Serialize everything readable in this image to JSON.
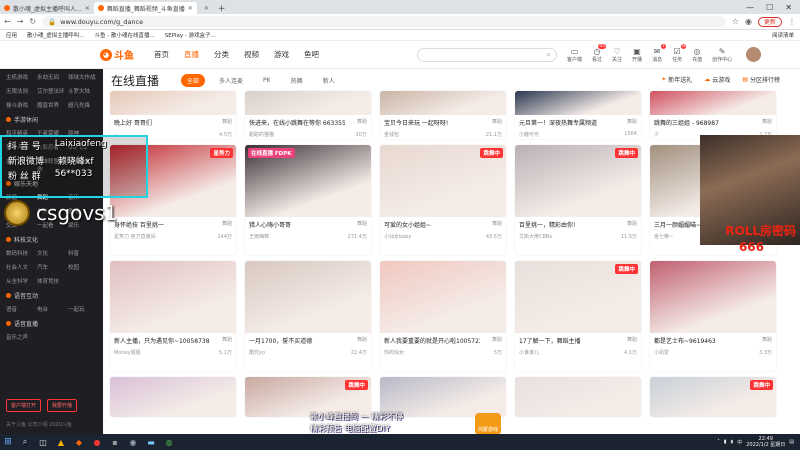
{
  "browser": {
    "tabs": [
      {
        "label": "散小魂_虚拟主播呼叫人...",
        "active": false
      },
      {
        "label": "舞蹈直播_舞蹈视频_斗鱼直播",
        "active": true
      },
      {
        "label": "",
        "active": false
      }
    ],
    "url": "www.douyu.com/g_dance",
    "update_label": "更新",
    "bookmarks": [
      "应用",
      "散小魂_虚拟主播呼叫...",
      "斗鱼 - 散小魂在线直播...",
      "SEPlay - 游戏盒子..."
    ],
    "reading_list": "阅读清单"
  },
  "site": {
    "logo": "斗鱼",
    "nav": [
      {
        "label": "首页",
        "active": false
      },
      {
        "label": "直播",
        "active": true
      },
      {
        "label": "分类",
        "active": false
      },
      {
        "label": "视频",
        "active": false
      },
      {
        "label": "游戏",
        "active": false
      },
      {
        "label": "鱼吧",
        "active": false
      }
    ],
    "search_icon": "search-icon",
    "header_icons": [
      {
        "label": "客户端",
        "icon": "download-icon",
        "badge": ""
      },
      {
        "label": "看过",
        "icon": "history-icon",
        "badge": "45"
      },
      {
        "label": "关注",
        "icon": "follow-icon",
        "badge": ""
      },
      {
        "label": "开播",
        "icon": "broadcast-icon",
        "badge": ""
      },
      {
        "label": "消息",
        "icon": "message-icon",
        "badge": "1"
      },
      {
        "label": "任务",
        "icon": "task-icon",
        "badge": "8"
      },
      {
        "label": "充值",
        "icon": "recharge-icon",
        "badge": ""
      },
      {
        "label": "创作中心",
        "icon": "create-icon",
        "badge": ""
      }
    ]
  },
  "sidebar": {
    "top_items": [
      "主机游戏",
      "永劫无间",
      "球球大作战",
      "无限法则",
      "艾尔登法环",
      "斗罗大陆",
      "格斗游戏",
      "魔兽世界",
      "超凡先锋"
    ],
    "section1": "手游休闲",
    "section1_items": [
      "和平精英",
      "王者荣耀",
      "原神",
      "第五人格",
      "火影忍者",
      "QQ飞车",
      "金铲铲",
      "英雄联盟手游",
      "热门游戏"
    ],
    "section2": "娱乐天地",
    "section2_items": [
      "颜值",
      "舞蹈",
      "音乐",
      "二次元",
      "户外",
      "鱼塘",
      "交友",
      "一起看",
      "娱乐"
    ],
    "section3": "科技文化",
    "section3_items": [
      "数码科技",
      "文化",
      "科普",
      "社会人文",
      "汽车",
      "校园",
      "从全科学",
      "体育竞技"
    ],
    "section4": "语音互动",
    "section4_items": [
      "语音",
      "电台",
      "一起玩"
    ],
    "section5": "语音直播",
    "section5_items": [
      "音乐之声"
    ],
    "btn_client": "客户端打开",
    "btn_start": "我要开播",
    "footer": "关于斗鱼  公司介绍  2020斗鱼"
  },
  "page": {
    "title": "在线直播",
    "filters": [
      {
        "label": "全部",
        "active": true
      },
      {
        "label": "多人连麦",
        "active": false
      },
      {
        "label": "PK",
        "active": false
      },
      {
        "label": "热舞",
        "active": false
      },
      {
        "label": "新人",
        "active": false
      }
    ],
    "right_links": [
      "新年送礼",
      "云游戏",
      "分区排行榜"
    ]
  },
  "cards": [
    {
      "title": "晚上好 哥哥们",
      "cat": "舞蹈",
      "user": "...",
      "count": "4.5万",
      "tag": "",
      "tagpos": "",
      "color": "#e6c9b8",
      "short": true
    },
    {
      "title": "快进来，在线小跳舞在等你 6633551",
      "cat": "舞蹈",
      "user": "甜甜的猫猫",
      "count": "10万",
      "tag": "",
      "tagpos": "",
      "color": "#d8d0c8",
      "short": true
    },
    {
      "title": "宝贝今日来玩 一起呀呀!",
      "cat": "舞蹈",
      "user": "金钱包",
      "count": "21.1万",
      "tag": "",
      "tagpos": "",
      "color": "#c9b4a5",
      "short": true
    },
    {
      "title": "元旦第一！深夜热舞专属频道",
      "cat": "舞蹈",
      "user": "小鹿可可",
      "count": "1564",
      "tag": "",
      "tagpos": "",
      "color": "#2a3750",
      "short": true
    },
    {
      "title": "跳舞的三姐姐 - 968987",
      "cat": "舞蹈",
      "user": "少",
      "count": "2.7万",
      "tag": "",
      "tagpos": "",
      "color": "#d05060",
      "short": true
    },
    {
      "title": "身怀绝技 百里挑一",
      "cat": "舞蹈",
      "user": "星势力 官方直播间",
      "count": "144万",
      "tag": "星势力",
      "tagpos": "red",
      "color": "#c0262e",
      "short": false
    },
    {
      "title": "猎人心嗨小哥哥",
      "cat": "舞蹈",
      "user": "王雨嗨棉",
      "count": "271.4万",
      "tag": "在线直播 FDPK",
      "tagpos": "pink",
      "color": "#3a3036",
      "short": false
    },
    {
      "title": "可爱的女小姐姐~",
      "cat": "舞蹈",
      "user": "小仙女baby",
      "count": "43.5万",
      "tag": "跳舞中",
      "tagpos": "red",
      "color": "#e8d8d0",
      "short": false
    },
    {
      "title": "百里挑一，精彩由你!",
      "cat": "舞蹈",
      "user": "艾斯大佬CBBs",
      "count": "11.5万",
      "tag": "跳舞中",
      "tagpos": "red",
      "color": "#b8b0b4",
      "short": false
    },
    {
      "title": "三月一颜媚媚喵~",
      "cat": "舞蹈",
      "user": "金七嘛~",
      "count": "1.5万",
      "tag": "跳舞中",
      "tagpos": "red",
      "color": "#a0907e",
      "short": false
    },
    {
      "title": "新人主播，只为遇见你~10058738",
      "cat": "舞蹈",
      "user": "Money姐姐",
      "count": "5.1万",
      "tag": "",
      "tagpos": "",
      "color": "#e0c0c0",
      "short": false
    },
    {
      "title": "一月1700，誓不买道德",
      "cat": "舞蹈",
      "user": "酷兜yo",
      "count": "22.4万",
      "tag": "",
      "tagpos": "",
      "color": "#d8c8c0",
      "short": false
    },
    {
      "title": "新人我要重要的就是开心啦10057236",
      "cat": "舞蹈",
      "user": "你的仙女",
      "count": "5万",
      "tag": "",
      "tagpos": "",
      "color": "#f0c8c0",
      "short": false
    },
    {
      "title": "17了解一下，舞蹈主播",
      "cat": "舞蹈",
      "user": "小谁谁儿",
      "count": "4.1万",
      "tag": "跳舞中",
      "tagpos": "red",
      "color": "#e8e0dc",
      "short": false
    },
    {
      "title": "都是艺士布~9619463",
      "cat": "舞蹈",
      "user": "小凤爱",
      "count": "3.3万",
      "tag": "",
      "tagpos": "",
      "color": "#c06070",
      "short": false
    },
    {
      "title": "",
      "cat": "",
      "user": "",
      "count": "",
      "tag": "",
      "tagpos": "",
      "color": "#d8c0d8",
      "short": false,
      "tiny": true
    },
    {
      "title": "",
      "cat": "",
      "user": "",
      "count": "",
      "tag": "跳舞中",
      "tagpos": "red",
      "color": "#c8a8a0",
      "short": false,
      "tiny": true
    },
    {
      "title": "",
      "cat": "",
      "user": "",
      "count": "",
      "tag": "",
      "tagpos": "",
      "color": "#b8b8c8",
      "short": false,
      "tiny": true
    },
    {
      "title": "",
      "cat": "",
      "user": "",
      "count": "",
      "tag": "",
      "tagpos": "",
      "color": "#e8e0e0",
      "short": false,
      "tiny": true
    },
    {
      "title": "",
      "cat": "",
      "user": "",
      "count": "",
      "tag": "跳舞中",
      "tagpos": "red",
      "color": "#c8d0d8",
      "short": false,
      "tiny": true
    }
  ],
  "stream_overlay": {
    "douyin_label": "抖 音 号",
    "douyin_value": "Laixiaofeng",
    "weibo_label": "新浪微博",
    "weibo_value": "赖晓峰xf",
    "fans_label": "粉 丝 群",
    "fans_value": "56**033",
    "game_name": "csgovs1",
    "roll_text": "ROLL房密码",
    "room_code": "666",
    "danmu1": "赖小峰直播间 — 精彩不停",
    "danmu2": "精彩预告 电脑配置DIY",
    "game_badge": "鸿蒙游戏"
  },
  "taskbar": {
    "time": "22:49",
    "date": "2022/1/2 星期日",
    "lang": "中"
  }
}
